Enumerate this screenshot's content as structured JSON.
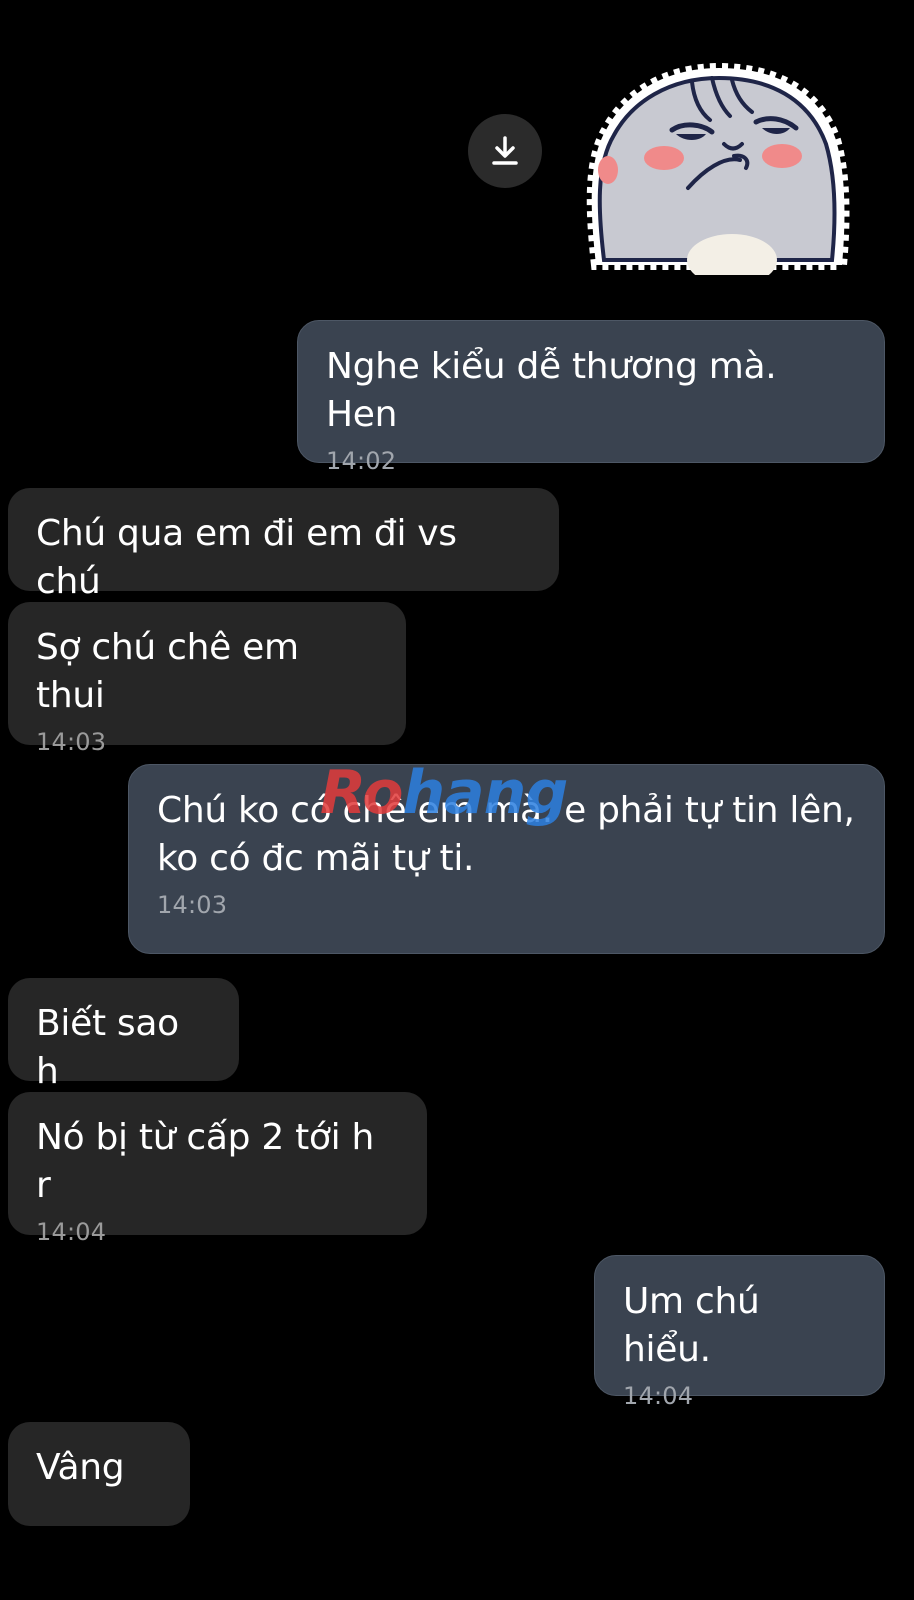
{
  "sticker": {
    "icon": "smug-cat-sticker"
  },
  "download": {
    "icon": "download-icon"
  },
  "messages": [
    {
      "direction": "out",
      "text": "Nghe kiểu dễ thương mà. Hen",
      "time": "14:02"
    },
    {
      "direction": "in",
      "text": "Chú qua em đi em đi vs chú",
      "time": ""
    },
    {
      "direction": "in",
      "text": "Sợ chú chê em thui",
      "time": "14:03"
    },
    {
      "direction": "out",
      "text": "Chú ko có chê em mà. e phải tự tin lên,\nko có đc mãi tự ti.",
      "time": "14:03"
    },
    {
      "direction": "in",
      "text": "Biết sao h",
      "time": ""
    },
    {
      "direction": "in",
      "text": "Nó bị từ cấp 2 tới h r",
      "time": "14:04"
    },
    {
      "direction": "out",
      "text": "Um chú hiểu.",
      "time": "14:04"
    },
    {
      "direction": "in",
      "text": "Vâng",
      "time": ""
    }
  ],
  "watermark": {
    "part1": "Ro",
    "part2": "hang"
  },
  "colors": {
    "background": "#000000",
    "incoming_bubble": "#262626",
    "outgoing_bubble": "#3a4350",
    "timestamp": "#a1a6ad"
  }
}
